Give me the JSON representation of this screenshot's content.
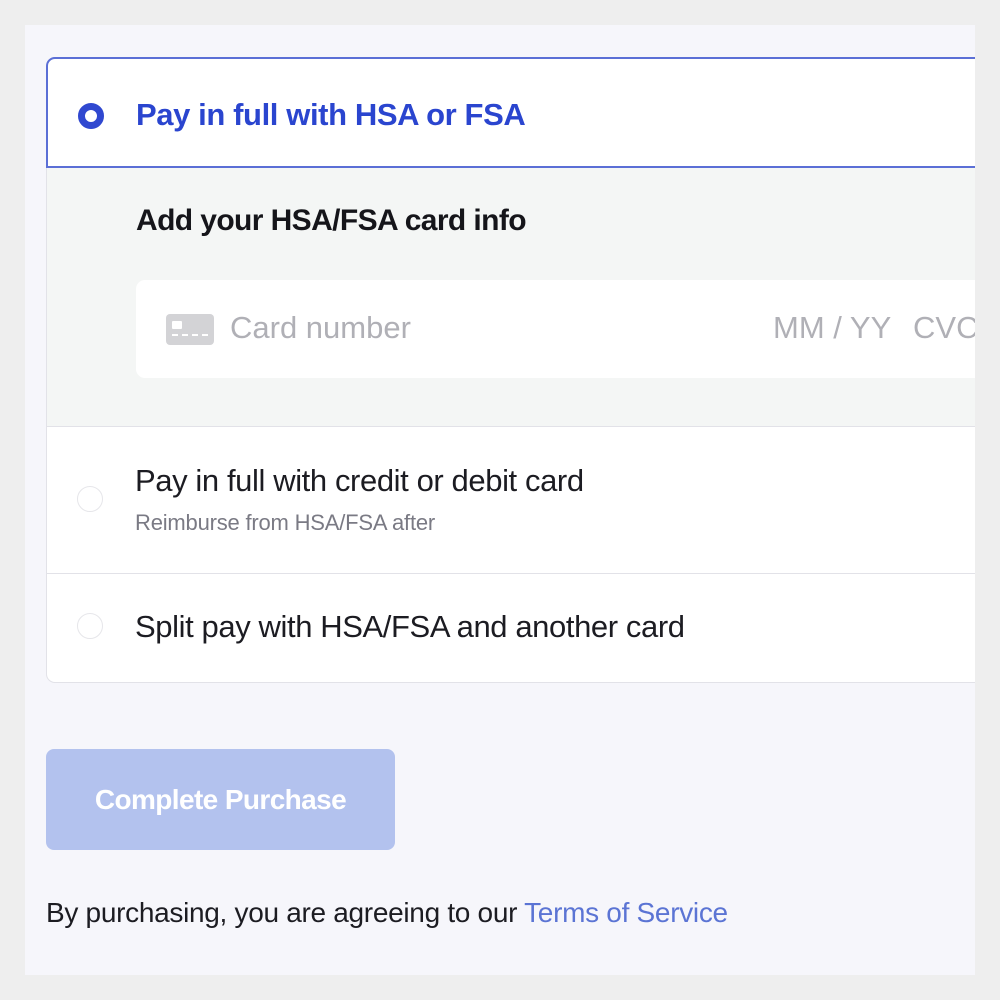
{
  "payment_options": {
    "hsa_full": {
      "label": "Pay in full with HSA or FSA",
      "selected": true
    },
    "card_panel": {
      "heading": "Add your HSA/FSA card info",
      "card_number_placeholder": "Card number",
      "expiry_placeholder": "MM / YY",
      "cvc_placeholder": "CVC",
      "card_icon": "credit-card-icon"
    },
    "credit_full": {
      "label": "Pay in full with credit or debit card",
      "sublabel": "Reimburse from HSA/FSA after",
      "selected": false
    },
    "split_pay": {
      "label": "Split pay with HSA/FSA and another card",
      "selected": false
    }
  },
  "purchase_button": {
    "label": "Complete Purchase"
  },
  "terms": {
    "prefix": "By purchasing, you are agreeing to our ",
    "link_text": "Terms of Service"
  },
  "colors": {
    "accent": "#2a45cf",
    "button_disabled": "#b3c2ee",
    "link": "#5b74d4",
    "panel_bg": "#f4f6f5",
    "page_bg": "#f6f6fb"
  }
}
